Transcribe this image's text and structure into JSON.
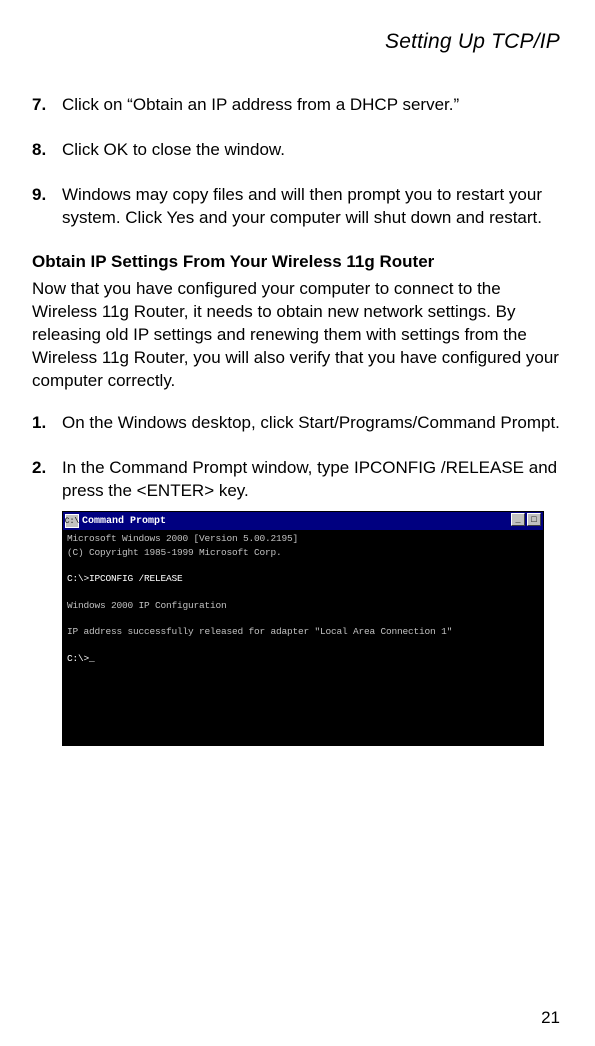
{
  "header": {
    "title": "Setting Up TCP/IP"
  },
  "steps_a": [
    {
      "num": "7.",
      "text": "Click on “Obtain an IP address from a DHCP server.”"
    },
    {
      "num": "8.",
      "text": "Click OK to close the window."
    },
    {
      "num": "9.",
      "text": "Windows may copy files and will then prompt you to restart your system. Click Yes and your computer will shut down and restart."
    }
  ],
  "section": {
    "heading": "Obtain IP Settings From Your Wireless 11g Router",
    "intro": "Now that you have configured your computer to connect to the Wireless 11g Router, it needs to obtain new network settings. By releasing old IP settings and renewing them with settings from the Wireless 11g Router, you will also verify that you have configured your computer correctly."
  },
  "steps_b": [
    {
      "num": "1.",
      "text": "On the Windows desktop, click Start/Programs/Command Prompt."
    },
    {
      "num": "2.",
      "text": "In the Command Prompt window, type IPCONFIG /RELEASE and press the <ENTER> key."
    }
  ],
  "cmd": {
    "title": "Command Prompt",
    "minimize": "_",
    "maximize": "□",
    "line1": "Microsoft Windows 2000 [Version 5.00.2195]",
    "line2": "(C) Copyright 1985-1999 Microsoft Corp.",
    "line3": "C:\\>IPCONFIG /RELEASE",
    "line4": "Windows 2000 IP Configuration",
    "line5": "IP address successfully released for adapter \"Local Area Connection 1\"",
    "line6": "C:\\>_"
  },
  "page_number": "21"
}
